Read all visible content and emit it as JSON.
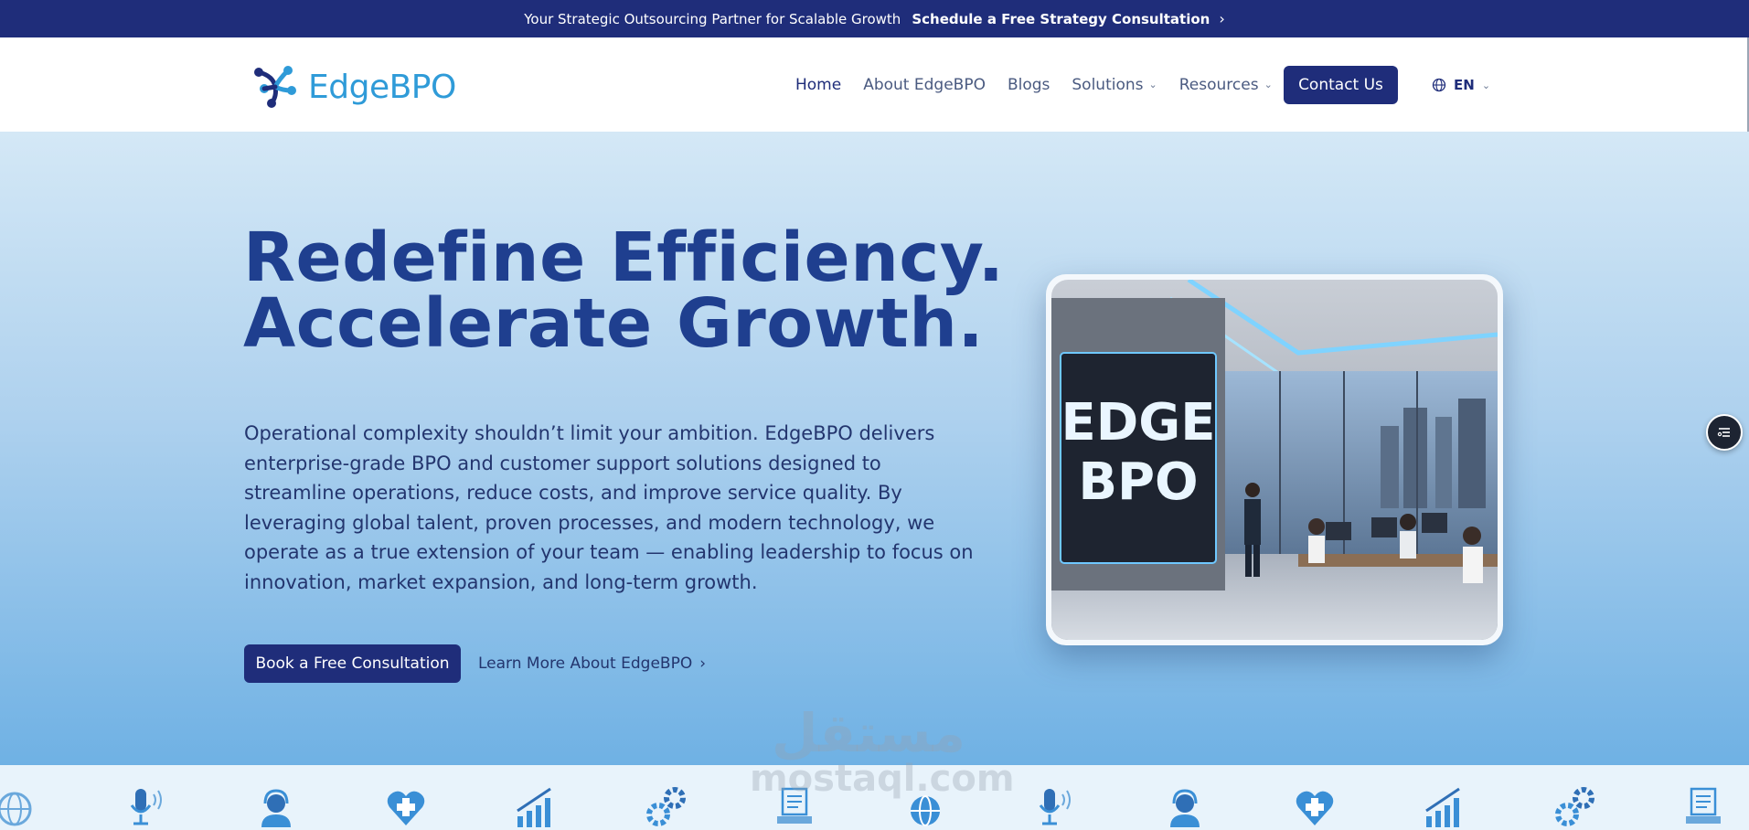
{
  "topbar": {
    "tagline": "Your Strategic Outsourcing Partner for Scalable Growth",
    "cta_label": "Schedule a Free Strategy Consultation",
    "cta_chevron": "›"
  },
  "brand": {
    "name": "EdgeBPO",
    "logo_icon": "edgebpo-logo-mark",
    "primary_color": "#1f2d7a",
    "accent_color": "#2f9bd8"
  },
  "nav": {
    "items": [
      {
        "label": "Home",
        "active": true
      },
      {
        "label": "About EdgeBPO"
      },
      {
        "label": "Blogs"
      },
      {
        "label": "Solutions",
        "has_dropdown": true
      },
      {
        "label": "Resources",
        "has_dropdown": true
      }
    ],
    "caret": "⌄",
    "contact_label": "Contact Us",
    "language": "EN",
    "language_icon": "globe-icon"
  },
  "hero": {
    "headline_line1": "Redefine Efficiency.",
    "headline_line2": "Accelerate Growth.",
    "lead": "Operational complexity shouldn’t limit your ambition. EdgeBPO delivers enterprise-grade BPO and customer support solutions designed to streamline operations, reduce costs, and improve service quality. By leveraging global talent, proven processes, and modern technology, we operate as a true extension of your team — enabling leadership to focus on innovation, market expansion, and long-term growth.",
    "primary_button": "Book a Free Consultation",
    "secondary_link": "Learn More About EdgeBPO",
    "secondary_chevron": "›",
    "image_sign_line1": "EDGE",
    "image_sign_line2": "BPO"
  },
  "widget": {
    "icon": "menu-list-icon"
  },
  "icon_strip": {
    "icons": [
      "globe-icon",
      "microphone-icon",
      "headset-agent-icon",
      "health-heart-icon",
      "growth-chart-icon",
      "gears-icon",
      "laptop-document-icon",
      "globe-icon",
      "microphone-icon",
      "headset-agent-icon",
      "health-heart-icon",
      "growth-chart-icon",
      "gears-icon",
      "laptop-document-icon"
    ]
  },
  "watermark": {
    "arabic": "مستقل",
    "latin": "mostaql.com"
  }
}
